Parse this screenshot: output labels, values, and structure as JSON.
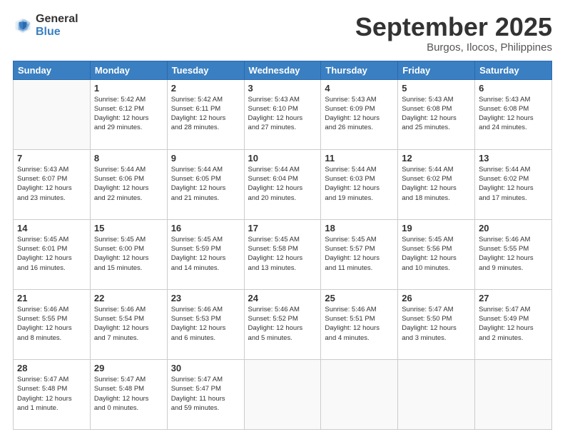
{
  "logo": {
    "general": "General",
    "blue": "Blue"
  },
  "header": {
    "month": "September 2025",
    "location": "Burgos, Ilocos, Philippines"
  },
  "weekdays": [
    "Sunday",
    "Monday",
    "Tuesday",
    "Wednesday",
    "Thursday",
    "Friday",
    "Saturday"
  ],
  "weeks": [
    [
      {
        "day": "",
        "empty": true
      },
      {
        "day": "1",
        "sunrise": "5:42 AM",
        "sunset": "6:12 PM",
        "daylight": "12 hours and 29 minutes."
      },
      {
        "day": "2",
        "sunrise": "5:42 AM",
        "sunset": "6:11 PM",
        "daylight": "12 hours and 28 minutes."
      },
      {
        "day": "3",
        "sunrise": "5:43 AM",
        "sunset": "6:10 PM",
        "daylight": "12 hours and 27 minutes."
      },
      {
        "day": "4",
        "sunrise": "5:43 AM",
        "sunset": "6:09 PM",
        "daylight": "12 hours and 26 minutes."
      },
      {
        "day": "5",
        "sunrise": "5:43 AM",
        "sunset": "6:08 PM",
        "daylight": "12 hours and 25 minutes."
      },
      {
        "day": "6",
        "sunrise": "5:43 AM",
        "sunset": "6:08 PM",
        "daylight": "12 hours and 24 minutes."
      }
    ],
    [
      {
        "day": "7",
        "sunrise": "5:43 AM",
        "sunset": "6:07 PM",
        "daylight": "12 hours and 23 minutes."
      },
      {
        "day": "8",
        "sunrise": "5:44 AM",
        "sunset": "6:06 PM",
        "daylight": "12 hours and 22 minutes."
      },
      {
        "day": "9",
        "sunrise": "5:44 AM",
        "sunset": "6:05 PM",
        "daylight": "12 hours and 21 minutes."
      },
      {
        "day": "10",
        "sunrise": "5:44 AM",
        "sunset": "6:04 PM",
        "daylight": "12 hours and 20 minutes."
      },
      {
        "day": "11",
        "sunrise": "5:44 AM",
        "sunset": "6:03 PM",
        "daylight": "12 hours and 19 minutes."
      },
      {
        "day": "12",
        "sunrise": "5:44 AM",
        "sunset": "6:02 PM",
        "daylight": "12 hours and 18 minutes."
      },
      {
        "day": "13",
        "sunrise": "5:44 AM",
        "sunset": "6:02 PM",
        "daylight": "12 hours and 17 minutes."
      }
    ],
    [
      {
        "day": "14",
        "sunrise": "5:45 AM",
        "sunset": "6:01 PM",
        "daylight": "12 hours and 16 minutes."
      },
      {
        "day": "15",
        "sunrise": "5:45 AM",
        "sunset": "6:00 PM",
        "daylight": "12 hours and 15 minutes."
      },
      {
        "day": "16",
        "sunrise": "5:45 AM",
        "sunset": "5:59 PM",
        "daylight": "12 hours and 14 minutes."
      },
      {
        "day": "17",
        "sunrise": "5:45 AM",
        "sunset": "5:58 PM",
        "daylight": "12 hours and 13 minutes."
      },
      {
        "day": "18",
        "sunrise": "5:45 AM",
        "sunset": "5:57 PM",
        "daylight": "12 hours and 11 minutes."
      },
      {
        "day": "19",
        "sunrise": "5:45 AM",
        "sunset": "5:56 PM",
        "daylight": "12 hours and 10 minutes."
      },
      {
        "day": "20",
        "sunrise": "5:46 AM",
        "sunset": "5:55 PM",
        "daylight": "12 hours and 9 minutes."
      }
    ],
    [
      {
        "day": "21",
        "sunrise": "5:46 AM",
        "sunset": "5:55 PM",
        "daylight": "12 hours and 8 minutes."
      },
      {
        "day": "22",
        "sunrise": "5:46 AM",
        "sunset": "5:54 PM",
        "daylight": "12 hours and 7 minutes."
      },
      {
        "day": "23",
        "sunrise": "5:46 AM",
        "sunset": "5:53 PM",
        "daylight": "12 hours and 6 minutes."
      },
      {
        "day": "24",
        "sunrise": "5:46 AM",
        "sunset": "5:52 PM",
        "daylight": "12 hours and 5 minutes."
      },
      {
        "day": "25",
        "sunrise": "5:46 AM",
        "sunset": "5:51 PM",
        "daylight": "12 hours and 4 minutes."
      },
      {
        "day": "26",
        "sunrise": "5:47 AM",
        "sunset": "5:50 PM",
        "daylight": "12 hours and 3 minutes."
      },
      {
        "day": "27",
        "sunrise": "5:47 AM",
        "sunset": "5:49 PM",
        "daylight": "12 hours and 2 minutes."
      }
    ],
    [
      {
        "day": "28",
        "sunrise": "5:47 AM",
        "sunset": "5:48 PM",
        "daylight": "12 hours and 1 minute."
      },
      {
        "day": "29",
        "sunrise": "5:47 AM",
        "sunset": "5:48 PM",
        "daylight": "12 hours and 0 minutes."
      },
      {
        "day": "30",
        "sunrise": "5:47 AM",
        "sunset": "5:47 PM",
        "daylight": "11 hours and 59 minutes."
      },
      {
        "day": "",
        "empty": true
      },
      {
        "day": "",
        "empty": true
      },
      {
        "day": "",
        "empty": true
      },
      {
        "day": "",
        "empty": true
      }
    ]
  ]
}
